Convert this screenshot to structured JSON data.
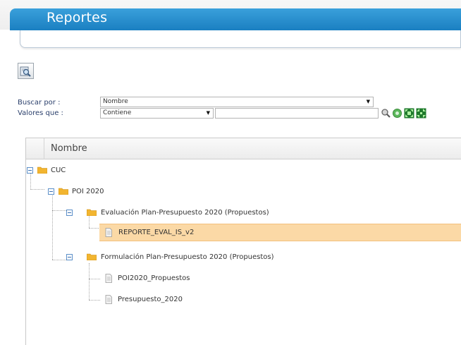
{
  "header": {
    "title": "Reportes"
  },
  "toolbar": {
    "search_tool": "search-tool-icon"
  },
  "filters": {
    "buscar_label": "Buscar por :",
    "buscar_value": "Nombre",
    "valores_label": "Valores que :",
    "valores_value": "Contiene",
    "valores_text": ""
  },
  "actions": [
    "search-go-icon",
    "reset-icon",
    "expand-all-icon",
    "collapse-all-icon"
  ],
  "grid": {
    "column": "Nombre",
    "nodes": [
      {
        "label": "CUC",
        "type": "folder",
        "level": 0
      },
      {
        "label": "POI 2020",
        "type": "folder",
        "level": 1
      },
      {
        "label": "Evaluación Plan-Presupuesto 2020 (Propuestos)",
        "type": "folder",
        "level": 2
      },
      {
        "label": "REPORTE_EVAL_IS_v2",
        "type": "report",
        "level": 3,
        "selected": true
      },
      {
        "label": "Formulación Plan-Presupuesto 2020 (Propuestos)",
        "type": "folder",
        "level": 2
      },
      {
        "label": "POI2020_Propuestos",
        "type": "report",
        "level": 3
      },
      {
        "label": "Presupuesto_2020",
        "type": "report",
        "level": 3
      }
    ]
  },
  "colors": {
    "header_blue": "#1a7fc1",
    "selected_row": "#fbd9a6",
    "folder": "#f2b530"
  }
}
